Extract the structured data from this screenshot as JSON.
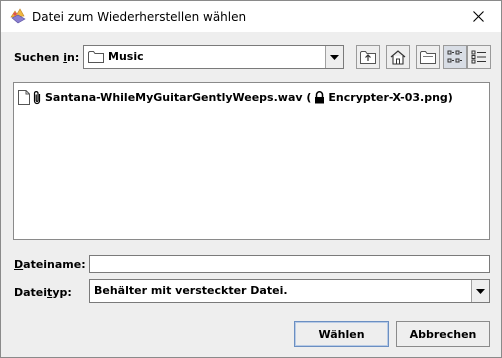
{
  "window": {
    "title": "Datei zum Wiederherstellen wählen"
  },
  "look_in": {
    "label_prefix": "Suchen ",
    "label_mnemonic": "i",
    "label_suffix": "n:",
    "folder": "Music"
  },
  "toolbar": {
    "icons": [
      "up-folder-icon",
      "home-icon",
      "new-folder-icon",
      "list-view-icon",
      "details-view-icon"
    ],
    "active_view": "list"
  },
  "files": [
    {
      "name": "Santana-WhileMyGuitarGentlyWeeps.wav (",
      "container": "Encrypter-X-03.png)"
    }
  ],
  "filename": {
    "label_mnemonic": "D",
    "label_rest": "ateiname:",
    "value": ""
  },
  "filetype": {
    "label_prefix": "Datei",
    "label_mnemonic": "t",
    "label_suffix": "yp:",
    "value": "Behälter mit versteckter Datei."
  },
  "buttons": {
    "choose": "Wählen",
    "cancel": "Abbrechen"
  }
}
